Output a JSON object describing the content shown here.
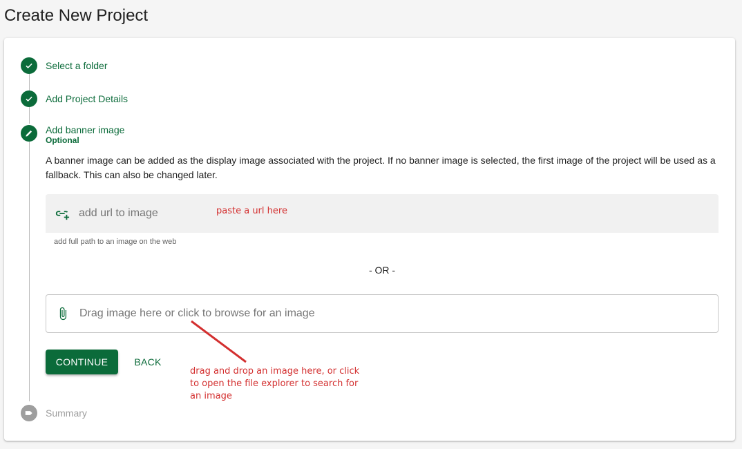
{
  "page": {
    "title": "Create New Project"
  },
  "stepper": {
    "steps": [
      {
        "label": "Select a folder",
        "state": "complete",
        "icon": "check-icon"
      },
      {
        "label": "Add Project Details",
        "state": "complete",
        "icon": "check-icon"
      },
      {
        "label": "Add banner image",
        "optional": "Optional",
        "state": "active",
        "icon": "pencil-icon"
      },
      {
        "label": "Summary",
        "state": "disabled",
        "icon": "summary-icon"
      }
    ]
  },
  "banner": {
    "description": "A banner image can be added as the display image associated with the project. If no banner image is selected, the first image of the project will be used as a fallback. This can also be changed later.",
    "url_field": {
      "placeholder": "add url to image",
      "value": "",
      "hint": "add full path to an image on the web",
      "icon": "link-add-icon"
    },
    "separator": "- OR -",
    "drop_zone": {
      "text": "Drag image here or click to browse for an image",
      "icon": "paperclip-icon"
    }
  },
  "actions": {
    "continue_label": "CONTINUE",
    "back_label": "BACK"
  },
  "annotations": {
    "url_note": "paste a url here",
    "drop_note": "drag and drop an image here, or click to open the file explorer to search for an image"
  },
  "colors": {
    "primary": "#0b6b3a",
    "annotation": "#d32f2f",
    "disabled": "#9e9e9e"
  }
}
